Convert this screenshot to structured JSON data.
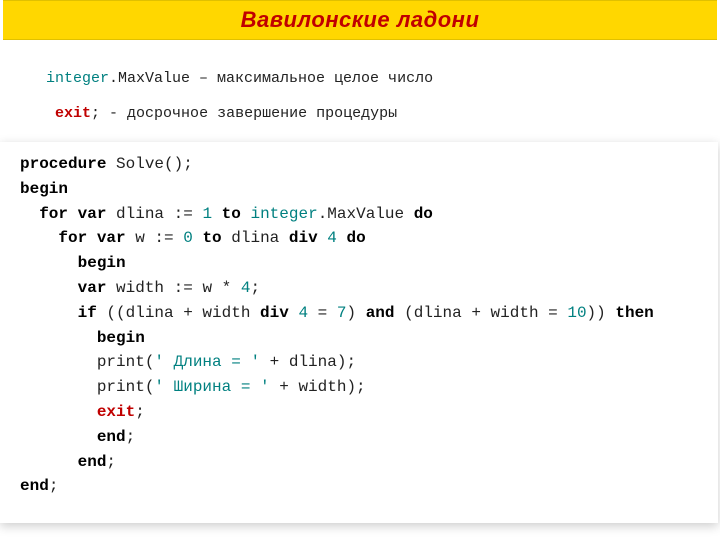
{
  "title": "Вавилонские ладони",
  "def_integer_kw": "integer",
  "def_integer_rest": ".MaxValue – максимальное целое число",
  "def_exit_kw": "exit",
  "def_exit_semi": ";",
  "def_exit_rest": "  - досрочное завершение процедуры",
  "code": {
    "l1a": "procedure",
    "l1b": " Solve();",
    "l2": "begin",
    "l3a": "  ",
    "l3b": "for var",
    "l3c": " dlina := ",
    "l3d": "1",
    "l3e": " ",
    "l3f": "to",
    "l3g": " ",
    "l3h": "integer",
    "l3i": ".MaxValue ",
    "l3j": "do",
    "l4a": "    ",
    "l4b": "for var",
    "l4c": " w := ",
    "l4d": "0",
    "l4e": " ",
    "l4f": "to",
    "l4g": " dlina ",
    "l4h": "div",
    "l4i": " ",
    "l4j": "4",
    "l4k": " ",
    "l4l": "do",
    "l5a": "      ",
    "l5b": "begin",
    "l6a": "      ",
    "l6b": "var",
    "l6c": " width := w * ",
    "l6d": "4",
    "l6e": ";",
    "l7a": "      ",
    "l7b": "if",
    "l7c": " ((dlina + width ",
    "l7d": "div",
    "l7e": " ",
    "l7f": "4",
    "l7g": " = ",
    "l7h": "7",
    "l7i": ") ",
    "l7j": "and",
    "l7k": " (dlina + width = ",
    "l7l": "10",
    "l7m": ")) ",
    "l7n": "then",
    "l8a": "        ",
    "l8b": "begin",
    "l9a": "        print(",
    "l9b": "' Длина = '",
    "l9c": " + dlina);",
    "l10a": "        print(",
    "l10b": "' Ширина = '",
    "l10c": " + width);",
    "l11a": "        ",
    "l11b": "exit",
    "l11c": ";",
    "l12a": "        ",
    "l12b": "end",
    "l12c": ";",
    "l13a": "      ",
    "l13b": "end",
    "l13c": ";",
    "l14a": "",
    "l14b": "end",
    "l14c": ";"
  }
}
